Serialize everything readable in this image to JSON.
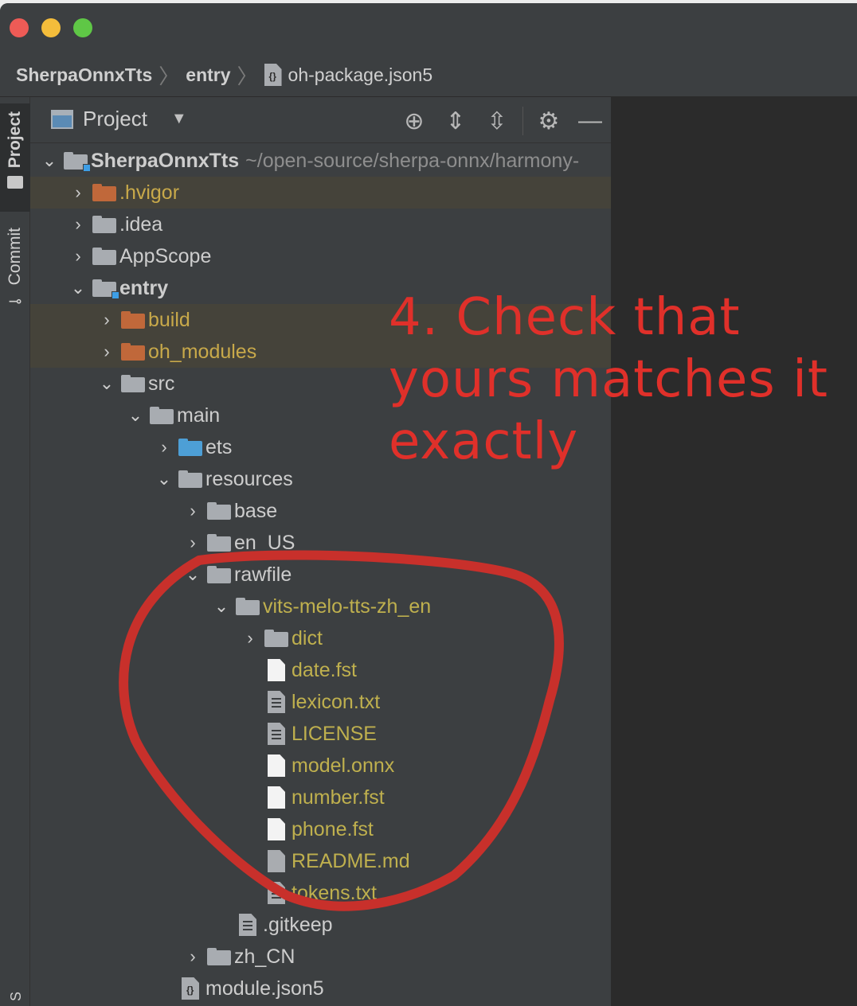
{
  "breadcrumb": {
    "project": "SherpaOnnxTts",
    "module": "entry",
    "file": "oh-package.json5"
  },
  "side_tabs": {
    "project": "Project",
    "commit": "Commit",
    "bottom": "S"
  },
  "panel": {
    "title": "Project",
    "tools": [
      "locate-icon",
      "expand-all-icon",
      "collapse-all-icon",
      "gear-icon",
      "minimize-icon"
    ]
  },
  "tree": {
    "root": {
      "name": "SherpaOnnxTts",
      "path": "~/open-source/sherpa-onnx/harmony-"
    },
    "hvigor": ".hvigor",
    "idea": ".idea",
    "appscope": "AppScope",
    "entry": "entry",
    "build": "build",
    "oh_modules": "oh_modules",
    "src": "src",
    "main": "main",
    "ets": "ets",
    "resources": "resources",
    "base": "base",
    "en_us": "en_US",
    "rawfile": "rawfile",
    "vits": "vits-melo-tts-zh_en",
    "dict": "dict",
    "date_fst": "date.fst",
    "lexicon": "lexicon.txt",
    "license": "LICENSE",
    "model": "model.onnx",
    "number_fst": "number.fst",
    "phone_fst": "phone.fst",
    "readme": "README.md",
    "tokens": "tokens.txt",
    "gitkeep": ".gitkeep",
    "zh_cn": "zh_CN",
    "module_json": "module.json5"
  },
  "annotation": {
    "text": "4. Check that yours matches it exactly",
    "color": "#e0302a"
  },
  "colors": {
    "ignored_folder": "#c0683a",
    "source_folder": "#4d9fd6",
    "untracked_text": "#bfb04e"
  }
}
